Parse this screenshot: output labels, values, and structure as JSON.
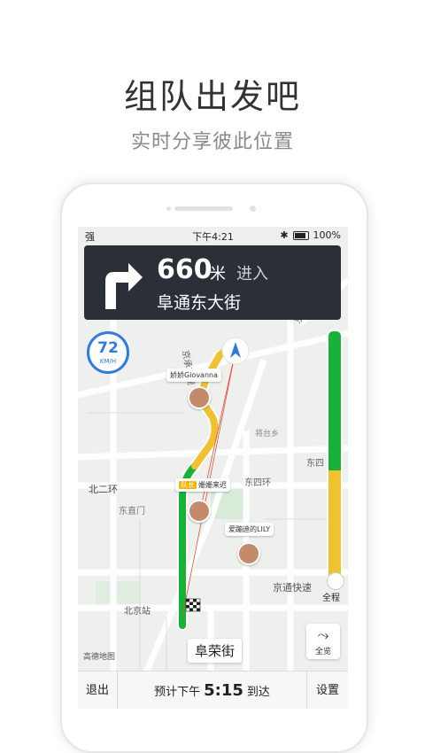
{
  "promo": {
    "title": "组队出发吧",
    "subtitle": "实时分享彼此位置"
  },
  "status_bar": {
    "signal": "强",
    "time": "下午4:21",
    "battery": "100%"
  },
  "navigation": {
    "turn_icon": "turn-right-arrow-icon",
    "distance": "660",
    "distance_unit": "米",
    "action": "进入",
    "street": "阜通东大街"
  },
  "speed": {
    "value": "72",
    "unit": "KM/H"
  },
  "map_labels": {
    "road1": "京承高速",
    "road2": "东四环",
    "road3": "北二环",
    "road4": "京通快速",
    "area1": "东直门",
    "area2": "北京站",
    "area3": "将台乡",
    "road5": "京密路",
    "road6": "东四"
  },
  "teammates": [
    {
      "name": "娇娇Giovanna",
      "tag": ""
    },
    {
      "name": "姗姗来迟",
      "tag": "队长"
    },
    {
      "name": "爱蹦迪的LILY",
      "tag": ""
    }
  ],
  "route_progress": {
    "label": "全程",
    "remaining_fraction": 0.45
  },
  "overview_button": {
    "label": "全览",
    "icon": "route-overview-icon"
  },
  "destination": "阜荣街",
  "map_logo": "高德地图",
  "bottom_bar": {
    "exit": "退出",
    "eta_prefix": "预计下午",
    "eta_time": "5:15",
    "eta_suffix": "到达",
    "settings": "设置"
  },
  "colors": {
    "route_green": "#16b339",
    "route_yellow": "#f2c12e",
    "nav_card": "#2b2f38",
    "accent_blue": "#2d7be5"
  }
}
